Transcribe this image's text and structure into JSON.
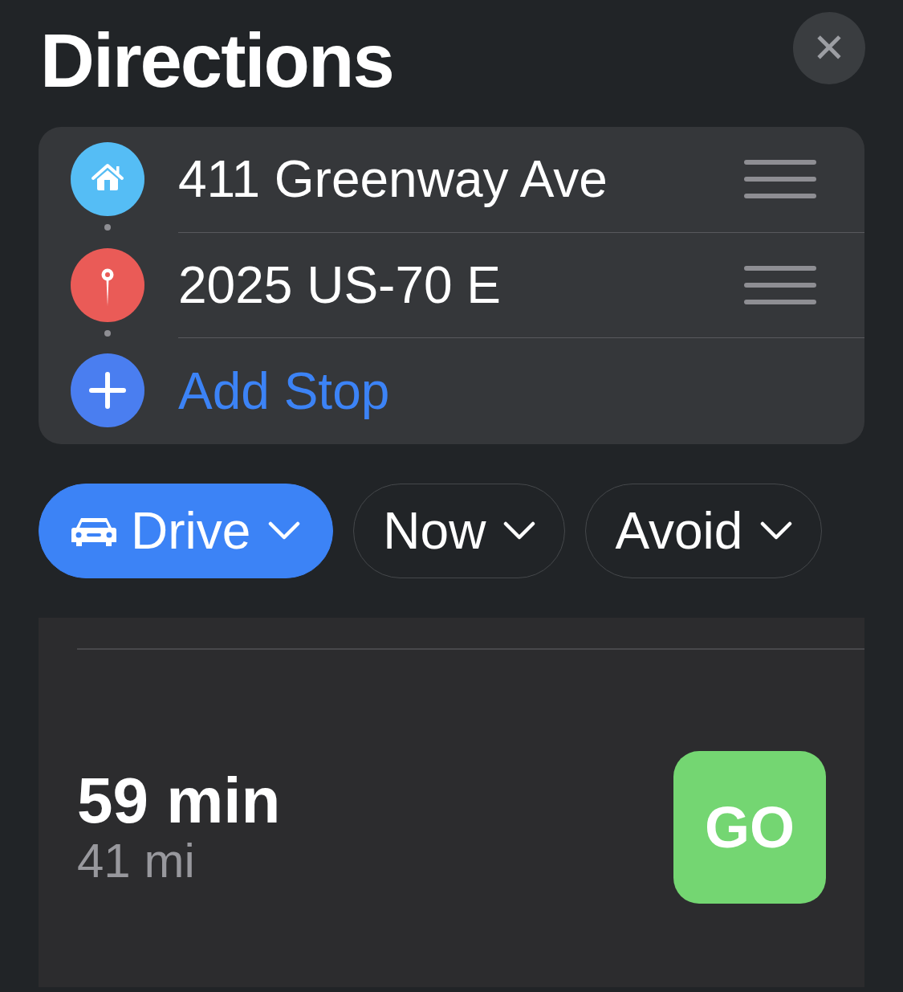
{
  "header": {
    "title": "Directions",
    "close_label": "✕"
  },
  "stops": [
    {
      "kind": "home",
      "label": "411 Greenway Ave"
    },
    {
      "kind": "destination",
      "label": "2025 US-70 E"
    },
    {
      "kind": "add",
      "label": "Add Stop"
    }
  ],
  "options": [
    {
      "label": "Drive",
      "kind": "mode",
      "selected": true
    },
    {
      "label": "Now",
      "kind": "plain",
      "selected": false
    },
    {
      "label": "Avoid",
      "kind": "plain",
      "selected": false
    }
  ],
  "route": {
    "duration": "59 min",
    "distance": "41 mi",
    "go_label": "GO"
  }
}
